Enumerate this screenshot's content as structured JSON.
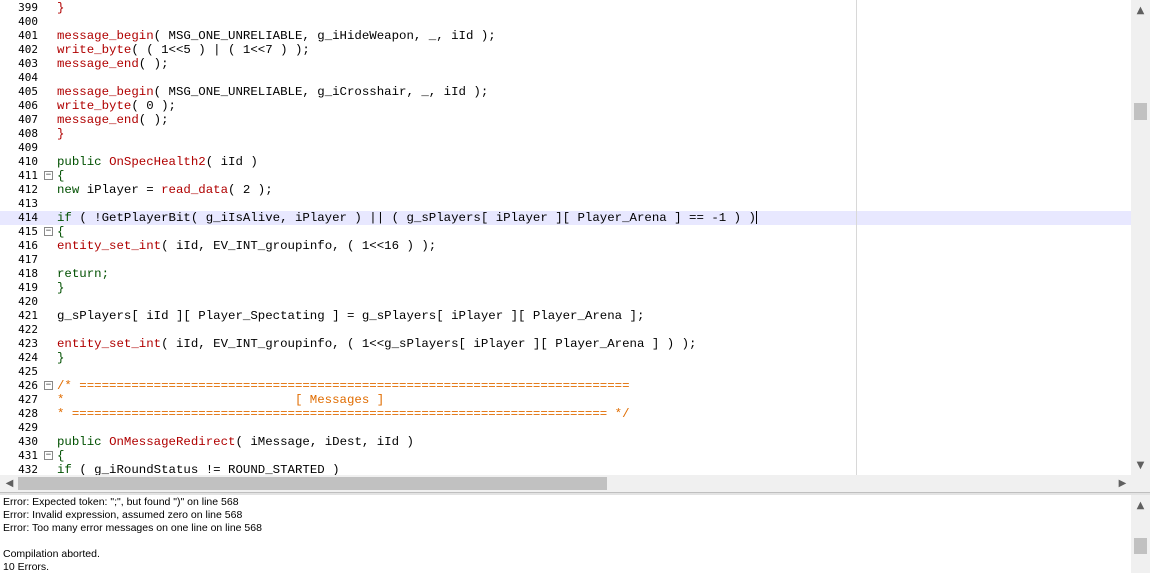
{
  "editor": {
    "lines": [
      {
        "number": "399",
        "fold": "",
        "current": false,
        "tokens": [
          {
            "text": "}",
            "cls": "c-call"
          }
        ]
      },
      {
        "number": "400",
        "fold": "",
        "current": false,
        "tokens": []
      },
      {
        "number": "401",
        "fold": "",
        "current": false,
        "tokens": [
          {
            "text": "message_begin",
            "cls": "c-call"
          },
          {
            "text": "( MSG_ONE_UNRELIABLE, g_iHideWeapon, _, iId );",
            "cls": "c-default"
          }
        ]
      },
      {
        "number": "402",
        "fold": "",
        "current": false,
        "tokens": [
          {
            "text": "write_byte",
            "cls": "c-call"
          },
          {
            "text": "( ( 1<<5 ) | ( 1<<7 ) );",
            "cls": "c-default"
          }
        ]
      },
      {
        "number": "403",
        "fold": "",
        "current": false,
        "tokens": [
          {
            "text": "message_end",
            "cls": "c-call"
          },
          {
            "text": "( );",
            "cls": "c-default"
          }
        ]
      },
      {
        "number": "404",
        "fold": "",
        "current": false,
        "tokens": []
      },
      {
        "number": "405",
        "fold": "",
        "current": false,
        "tokens": [
          {
            "text": "message_begin",
            "cls": "c-call"
          },
          {
            "text": "( MSG_ONE_UNRELIABLE, g_iCrosshair, _, iId );",
            "cls": "c-default"
          }
        ]
      },
      {
        "number": "406",
        "fold": "",
        "current": false,
        "tokens": [
          {
            "text": "write_byte",
            "cls": "c-call"
          },
          {
            "text": "( 0 );",
            "cls": "c-default"
          }
        ]
      },
      {
        "number": "407",
        "fold": "",
        "current": false,
        "tokens": [
          {
            "text": "message_end",
            "cls": "c-call"
          },
          {
            "text": "( );",
            "cls": "c-default"
          }
        ]
      },
      {
        "number": "408",
        "fold": "",
        "current": false,
        "tokens": [
          {
            "text": "}",
            "cls": "c-call"
          }
        ]
      },
      {
        "number": "409",
        "fold": "",
        "current": false,
        "tokens": []
      },
      {
        "number": "410",
        "fold": "",
        "current": false,
        "tokens": [
          {
            "text": "public ",
            "cls": "c-keyword"
          },
          {
            "text": "OnSpecHealth2",
            "cls": "c-call"
          },
          {
            "text": "( iId )",
            "cls": "c-default"
          }
        ]
      },
      {
        "number": "411",
        "fold": "−",
        "current": false,
        "tokens": [
          {
            "text": "{",
            "cls": "c-keyword"
          }
        ]
      },
      {
        "number": "412",
        "fold": "",
        "current": false,
        "tokens": [
          {
            "text": "new ",
            "cls": "c-keyword"
          },
          {
            "text": "iPlayer = ",
            "cls": "c-default"
          },
          {
            "text": "read_data",
            "cls": "c-call"
          },
          {
            "text": "( 2 );",
            "cls": "c-default"
          }
        ]
      },
      {
        "number": "413",
        "fold": "",
        "current": false,
        "tokens": []
      },
      {
        "number": "414",
        "fold": "",
        "current": true,
        "tokens": [
          {
            "text": "if ",
            "cls": "c-keyword"
          },
          {
            "text": "( !GetPlayerBit( g_iIsAlive, iPlayer ) || ( g_sPlayers[ iPlayer ][ Player_Arena ] == -1 ) )",
            "cls": "c-default"
          }
        ]
      },
      {
        "number": "415",
        "fold": "−",
        "current": false,
        "tokens": [
          {
            "text": "{",
            "cls": "c-keyword"
          }
        ]
      },
      {
        "number": "416",
        "fold": "",
        "current": false,
        "tokens": [
          {
            "text": "entity_set_int",
            "cls": "c-call"
          },
          {
            "text": "( iId, EV_INT_groupinfo, ( 1<<16 ) );",
            "cls": "c-default"
          }
        ]
      },
      {
        "number": "417",
        "fold": "",
        "current": false,
        "tokens": []
      },
      {
        "number": "418",
        "fold": "",
        "current": false,
        "tokens": [
          {
            "text": "return;",
            "cls": "c-keyword"
          }
        ]
      },
      {
        "number": "419",
        "fold": "",
        "current": false,
        "tokens": [
          {
            "text": "}",
            "cls": "c-keyword"
          }
        ]
      },
      {
        "number": "420",
        "fold": "",
        "current": false,
        "tokens": []
      },
      {
        "number": "421",
        "fold": "",
        "current": false,
        "tokens": [
          {
            "text": "g_sPlayers[ iId ][ Player_Spectating ] = g_sPlayers[ iPlayer ][ Player_Arena ];",
            "cls": "c-default"
          }
        ]
      },
      {
        "number": "422",
        "fold": "",
        "current": false,
        "tokens": []
      },
      {
        "number": "423",
        "fold": "",
        "current": false,
        "tokens": [
          {
            "text": "entity_set_int",
            "cls": "c-call"
          },
          {
            "text": "( iId, EV_INT_groupinfo, ( 1<<g_sPlayers[ iPlayer ][ Player_Arena ] ) );",
            "cls": "c-default"
          }
        ]
      },
      {
        "number": "424",
        "fold": "",
        "current": false,
        "tokens": [
          {
            "text": "}",
            "cls": "c-keyword"
          }
        ]
      },
      {
        "number": "425",
        "fold": "",
        "current": false,
        "tokens": []
      },
      {
        "number": "426",
        "fold": "−",
        "current": false,
        "tokens": [
          {
            "text": "/* ==========================================================================",
            "cls": "c-comment"
          }
        ]
      },
      {
        "number": "427",
        "fold": "",
        "current": false,
        "tokens": [
          {
            "text": "*                               [ Messages ]",
            "cls": "c-comment"
          }
        ]
      },
      {
        "number": "428",
        "fold": "",
        "current": false,
        "tokens": [
          {
            "text": "* ======================================================================== */",
            "cls": "c-comment"
          }
        ]
      },
      {
        "number": "429",
        "fold": "",
        "current": false,
        "tokens": []
      },
      {
        "number": "430",
        "fold": "",
        "current": false,
        "tokens": [
          {
            "text": "public ",
            "cls": "c-keyword"
          },
          {
            "text": "OnMessageRedirect",
            "cls": "c-call"
          },
          {
            "text": "( iMessage, iDest, iId )",
            "cls": "c-default"
          }
        ]
      },
      {
        "number": "431",
        "fold": "−",
        "current": false,
        "tokens": [
          {
            "text": "{",
            "cls": "c-keyword"
          }
        ]
      },
      {
        "number": "432",
        "fold": "",
        "current": false,
        "tokens": [
          {
            "text": "if ",
            "cls": "c-keyword"
          },
          {
            "text": "( g_iRoundStatus != ROUND_STARTED )",
            "cls": "c-default"
          }
        ]
      }
    ]
  },
  "output": {
    "lines": [
      "Error: Expected token: \";\", but found \")\" on line 568",
      "Error: Invalid expression, assumed zero on line 568",
      "Error: Too many error messages on one line on line 568",
      "",
      "Compilation aborted.",
      "10 Errors."
    ]
  },
  "scrollbars": {
    "up_arrow": "▲",
    "down_arrow": "▼",
    "left_arrow": "◀",
    "right_arrow": "▶"
  }
}
